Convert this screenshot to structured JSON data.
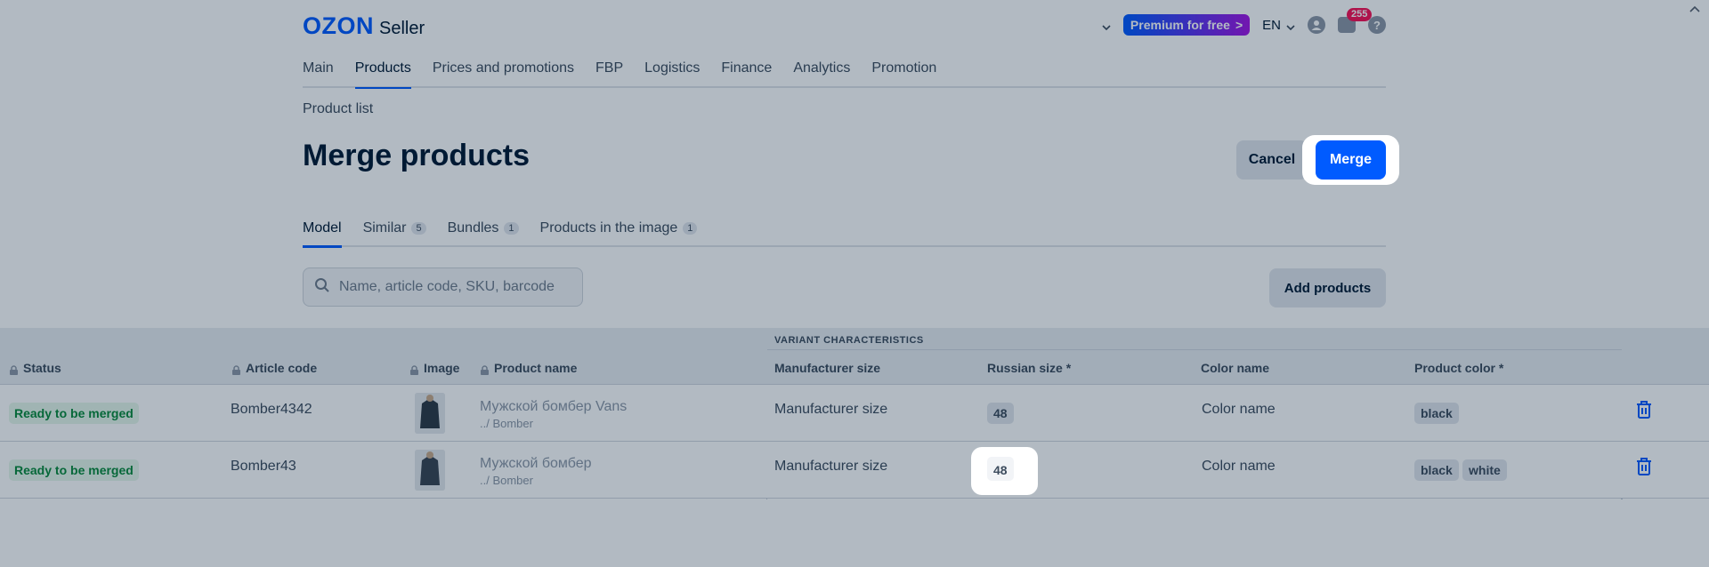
{
  "header": {
    "logo_brand": "OZON",
    "logo_product": "Seller",
    "premium_label": "Premium for free",
    "premium_arrow": ">",
    "language": "EN",
    "notifications_count": "255",
    "help_glyph": "?"
  },
  "nav": {
    "items": [
      {
        "label": "Main"
      },
      {
        "label": "Products"
      },
      {
        "label": "Prices and promotions"
      },
      {
        "label": "FBP"
      },
      {
        "label": "Logistics"
      },
      {
        "label": "Finance"
      },
      {
        "label": "Analytics"
      },
      {
        "label": "Promotion"
      }
    ],
    "active": "Products"
  },
  "breadcrumb": "Product list",
  "page_title": "Merge products",
  "actions": {
    "cancel_label": "Cancel",
    "merge_label": "Merge",
    "add_products_label": "Add products"
  },
  "tabs": [
    {
      "label": "Model",
      "count": ""
    },
    {
      "label": "Similar",
      "count": "5"
    },
    {
      "label": "Bundles",
      "count": "1"
    },
    {
      "label": "Products in the image",
      "count": "1"
    }
  ],
  "search": {
    "placeholder": "Name, article code, SKU, barcode"
  },
  "table": {
    "group_header": "VARIANT CHARACTERISTICS",
    "columns": {
      "status": "Status",
      "article": "Article code",
      "image": "Image",
      "product_name": "Product name",
      "manufacturer_size": "Manufacturer size",
      "russian_size": "Russian size *",
      "color_name": "Color name",
      "product_color": "Product color *"
    },
    "rows": [
      {
        "status": "Ready to be merged",
        "article": "Bomber4342",
        "product_name": "Мужской бомбер Vans",
        "category": "../ Bomber",
        "manufacturer_size": "Manufacturer size",
        "russian_size": "48",
        "color_name": "Color name",
        "colors": [
          "black"
        ]
      },
      {
        "status": "Ready to be merged",
        "article": "Bomber43",
        "product_name": "Мужской бомбер",
        "category": "../ Bomber",
        "manufacturer_size": "Manufacturer size",
        "russian_size": "48",
        "color_name": "Color name",
        "colors": [
          "black",
          "white"
        ]
      }
    ]
  },
  "colors": {
    "brand": "#005bff",
    "premium_gradient_end": "#a415e5",
    "badge_red": "#f91155",
    "status_green": "#0a8a3b",
    "overlay": "rgba(0,26,52,0.30)"
  },
  "icons": [
    "chevron-down-icon",
    "user-icon",
    "chat-icon",
    "help-icon",
    "search-icon",
    "lock-icon",
    "trash-icon",
    "back-arrow-icon"
  ]
}
